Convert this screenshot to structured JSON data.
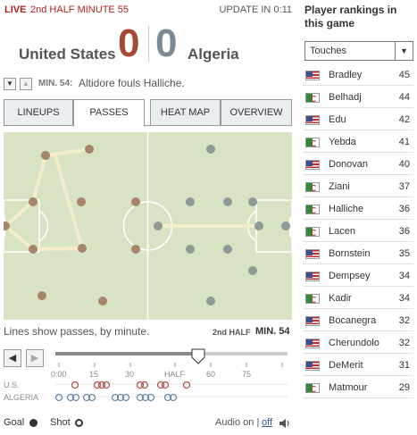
{
  "header": {
    "live_label": "LIVE",
    "period_label": "2nd HALF MINUTE 55",
    "update_label": "UPDATE IN 0:11"
  },
  "score": {
    "home_team": "United States",
    "home_score": "0",
    "away_score": "0",
    "away_team": "Algeria",
    "home_color": "#a24a33",
    "away_color": "#7a8b97"
  },
  "event": {
    "minute_label": "MIN. 54:",
    "text": "Altidore fouls Halliche."
  },
  "tabs": [
    {
      "label": "LINEUPS",
      "active": false
    },
    {
      "label": "PASSES",
      "active": true
    },
    {
      "label": "HEAT MAP",
      "active": false
    },
    {
      "label": "OVERVIEW",
      "active": false
    }
  ],
  "pitch": {
    "note": "Lines show passes, by minute.",
    "half_label": "2nd HALF",
    "minute_value": "MIN. 54"
  },
  "timeline": {
    "ticks": [
      "0:00",
      "15",
      "30",
      "HALF",
      "60",
      "75"
    ],
    "home_label": "U.S.",
    "away_label": "ALGERIA",
    "current_minute": 54
  },
  "legend": {
    "goal_label": "Goal",
    "shot_label": "Shot",
    "audio_label": "Audio on",
    "audio_sep": "|",
    "audio_off": "off"
  },
  "rankings": {
    "title": "Player rankings in this game",
    "metric": "Touches",
    "players": [
      {
        "name": "Bradley",
        "value": "45",
        "team": "us"
      },
      {
        "name": "Belhadj",
        "value": "44",
        "team": "dz"
      },
      {
        "name": "Edu",
        "value": "42",
        "team": "us"
      },
      {
        "name": "Yebda",
        "value": "41",
        "team": "dz"
      },
      {
        "name": "Donovan",
        "value": "40",
        "team": "us"
      },
      {
        "name": "Ziani",
        "value": "37",
        "team": "dz"
      },
      {
        "name": "Halliche",
        "value": "36",
        "team": "dz"
      },
      {
        "name": "Lacen",
        "value": "36",
        "team": "dz"
      },
      {
        "name": "Bornstein",
        "value": "35",
        "team": "us"
      },
      {
        "name": "Dempsey",
        "value": "34",
        "team": "us"
      },
      {
        "name": "Kadir",
        "value": "34",
        "team": "dz"
      },
      {
        "name": "Bocanegra",
        "value": "32",
        "team": "us"
      },
      {
        "name": "Cherundolo",
        "value": "32",
        "team": "us"
      },
      {
        "name": "DeMerit",
        "value": "31",
        "team": "us"
      },
      {
        "name": "Matmour",
        "value": "29",
        "team": "dz"
      }
    ]
  }
}
